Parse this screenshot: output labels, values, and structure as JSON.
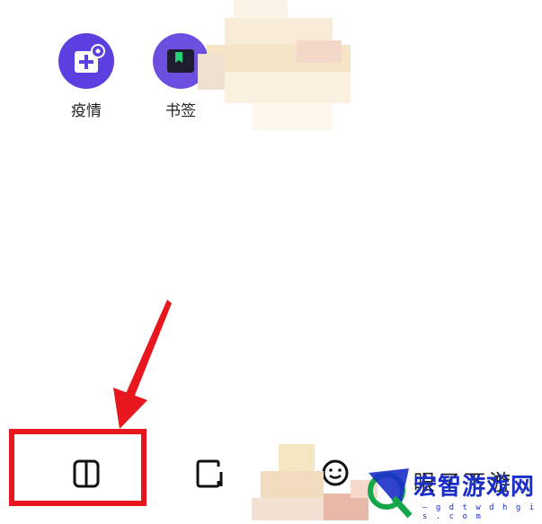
{
  "shortcuts": [
    {
      "label": "疫情",
      "icon": "medical-plus-gear-icon",
      "color": "#5b3fe0"
    },
    {
      "label": "书签",
      "icon": "bookmark-icon",
      "color": "#6d4fe0"
    }
  ],
  "bottom_nav": {
    "items": [
      {
        "icon": "book-icon"
      },
      {
        "icon": "tabs-icon"
      },
      {
        "icon": "smile-icon"
      }
    ],
    "obscured_text": "眼了下游"
  },
  "annotation": {
    "color": "#e8161d"
  },
  "watermark": {
    "text": "宏智游戏网",
    "sub": "— g d t w d h g i s . c o m",
    "color": "#1a2ec9"
  }
}
